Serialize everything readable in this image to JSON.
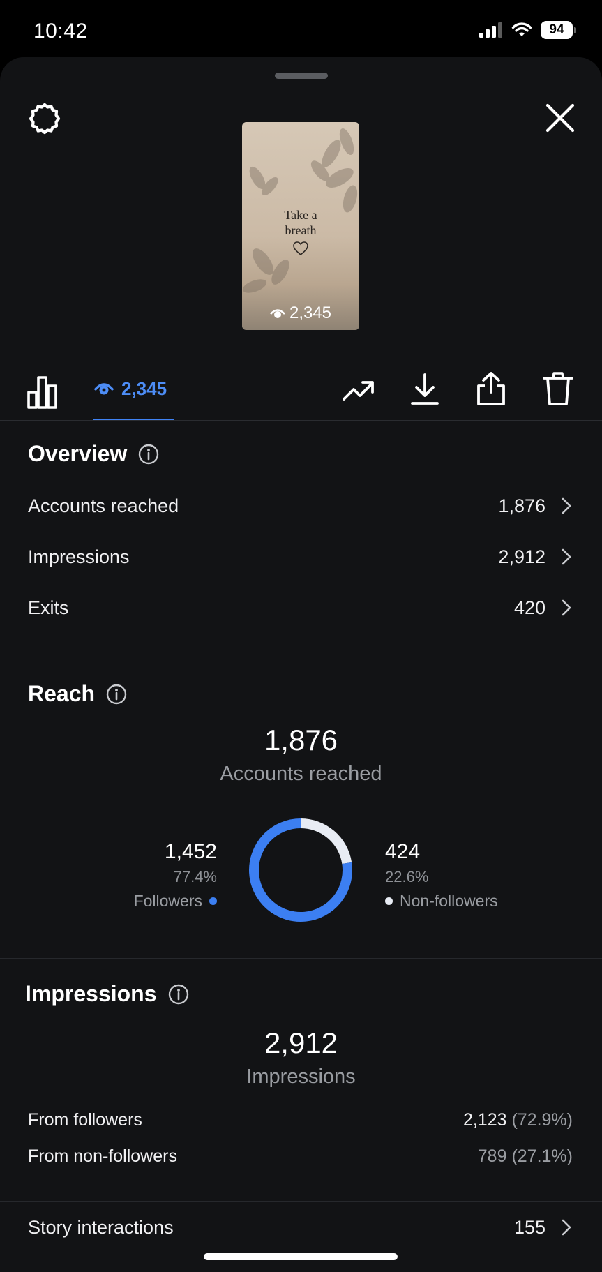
{
  "status_bar": {
    "time": "10:42",
    "battery": "94"
  },
  "story": {
    "text_line1": "Take a",
    "text_line2": "breath",
    "views": "2,345"
  },
  "toolbar": {
    "views_count": "2,345"
  },
  "overview": {
    "title": "Overview",
    "rows": [
      {
        "label": "Accounts reached",
        "value": "1,876"
      },
      {
        "label": "Impressions",
        "value": "2,912"
      },
      {
        "label": "Exits",
        "value": "420"
      }
    ]
  },
  "reach": {
    "title": "Reach",
    "total": "1,876",
    "total_label": "Accounts reached",
    "followers": {
      "count": "1,452",
      "percent": "77.4%",
      "label": "Followers"
    },
    "non_followers": {
      "count": "424",
      "percent": "22.6%",
      "label": "Non-followers"
    },
    "colors": {
      "followers": "#3c7ff2",
      "non_followers": "#e8ecf4"
    }
  },
  "chart_data": {
    "type": "pie",
    "categories": [
      "Followers",
      "Non-followers"
    ],
    "values": [
      77.4,
      22.6
    ],
    "counts": [
      1452,
      424
    ],
    "total": 1876,
    "title": "Accounts reached"
  },
  "impressions": {
    "title": "Impressions",
    "total": "2,912",
    "total_label": "Impressions",
    "from_followers": {
      "label": "From followers",
      "value": "2,123",
      "percent": "(72.9%)"
    },
    "from_non_followers": {
      "label": "From non-followers",
      "value": "789",
      "percent": "(27.1%)"
    }
  },
  "story_interactions": {
    "label": "Story interactions",
    "value": "155"
  },
  "colors": {
    "accent": "#3f83f5",
    "background": "#121315"
  }
}
